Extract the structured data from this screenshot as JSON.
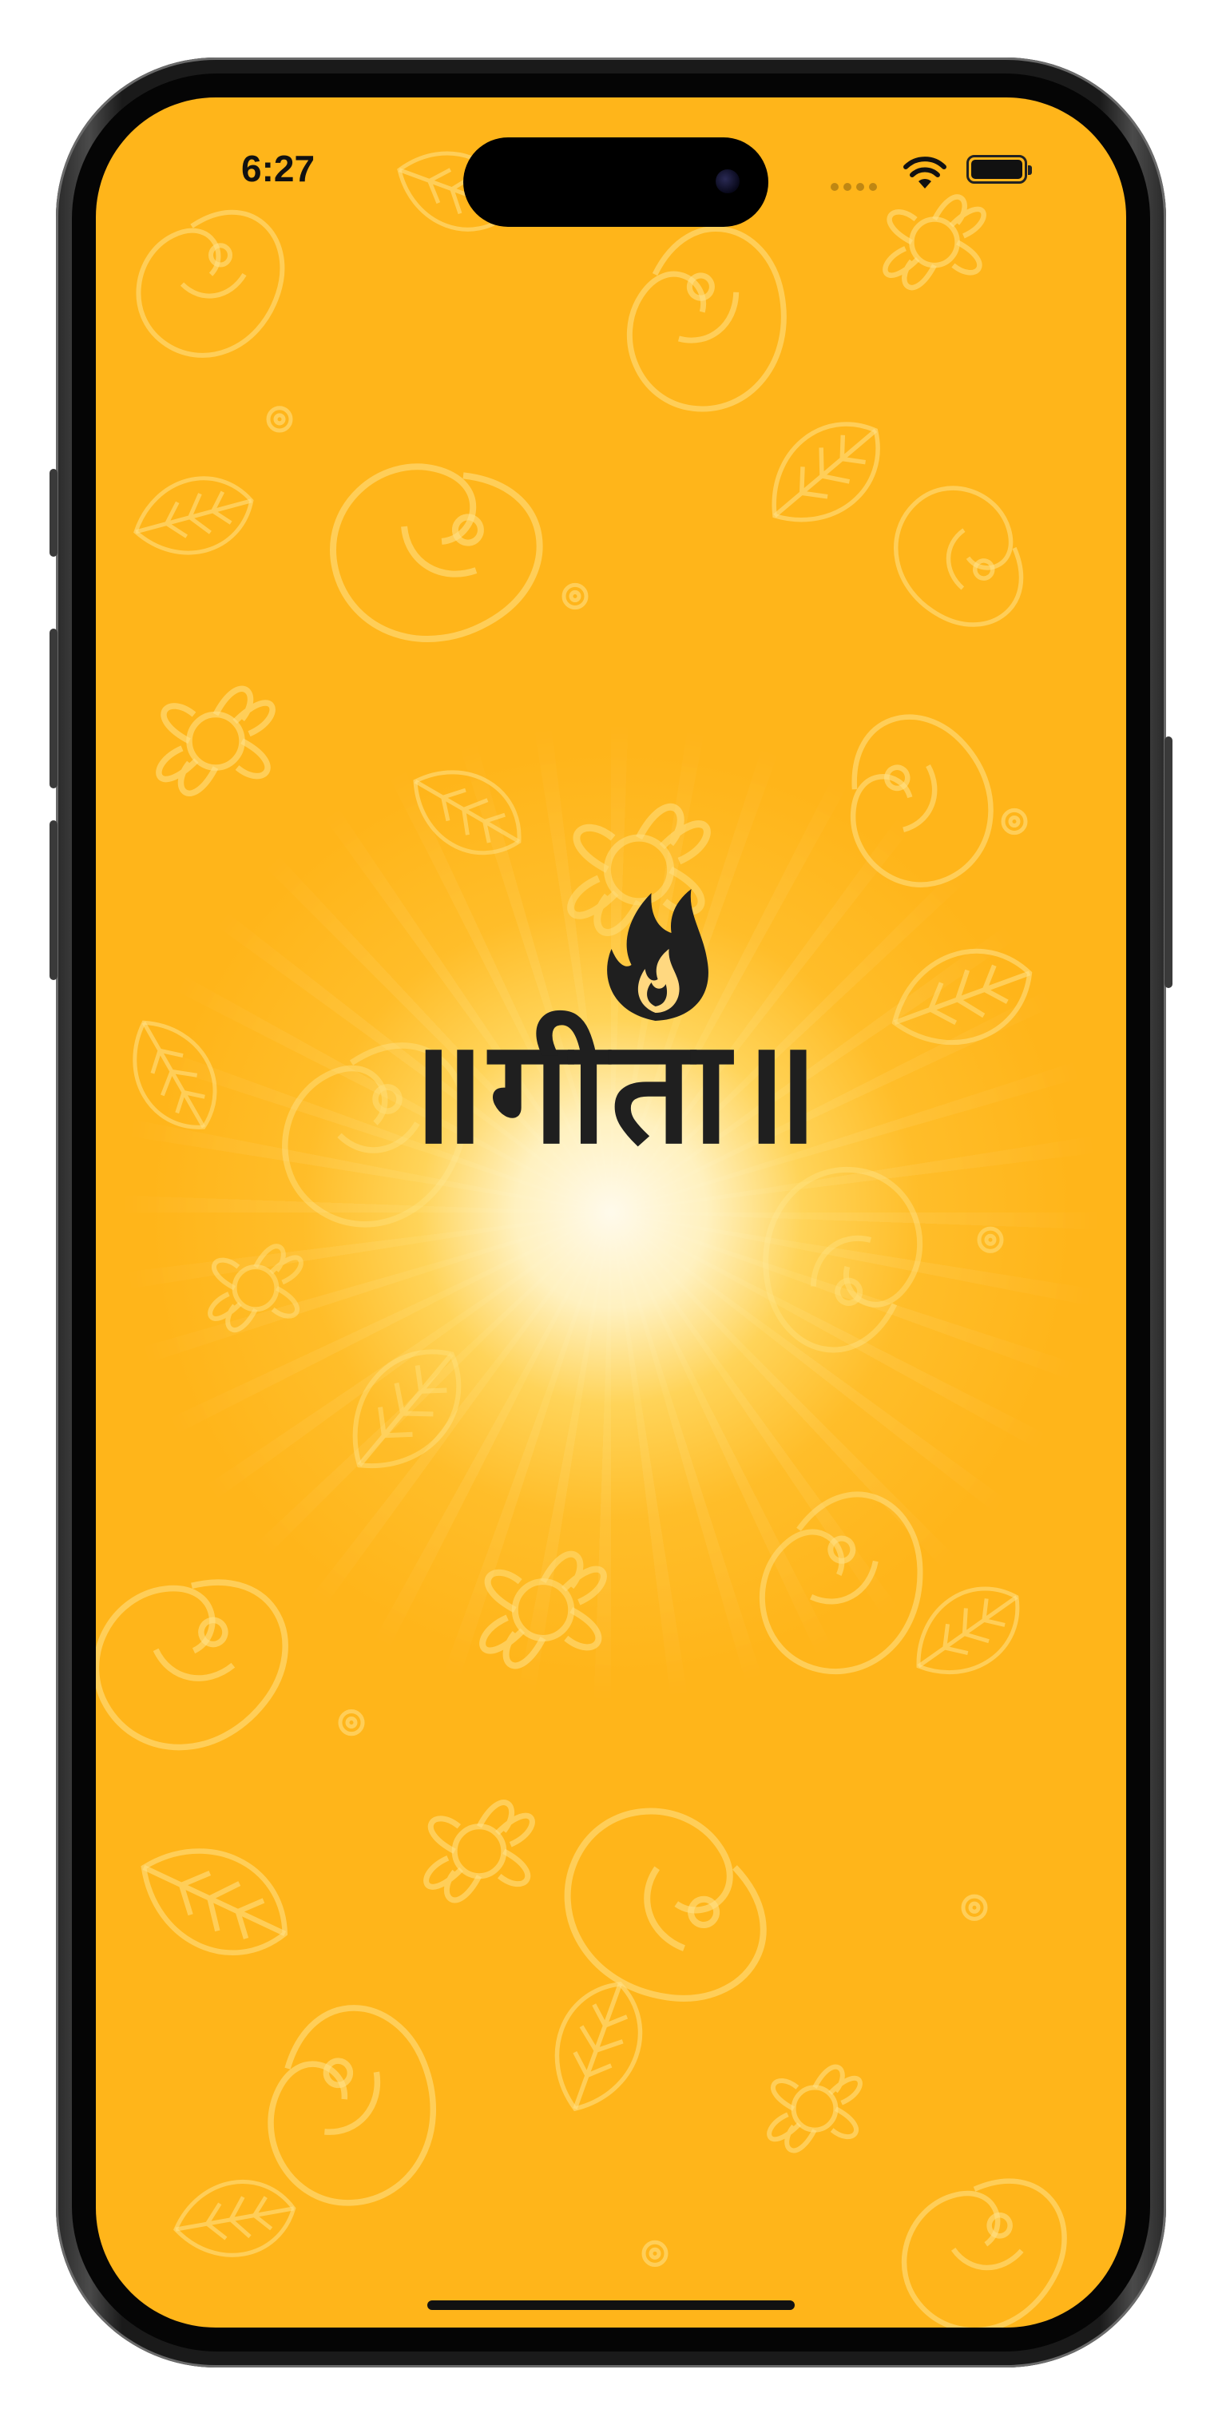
{
  "status_bar": {
    "time": "6:27",
    "wifi_icon": "wifi-icon",
    "battery_icon": "battery-icon"
  },
  "splash": {
    "logo_text": "॥गीता॥",
    "logo_icon": "flame-icon",
    "background_color": "#ffb51a",
    "glow_color": "#fff8e0",
    "text_color": "#1f1f1f"
  }
}
